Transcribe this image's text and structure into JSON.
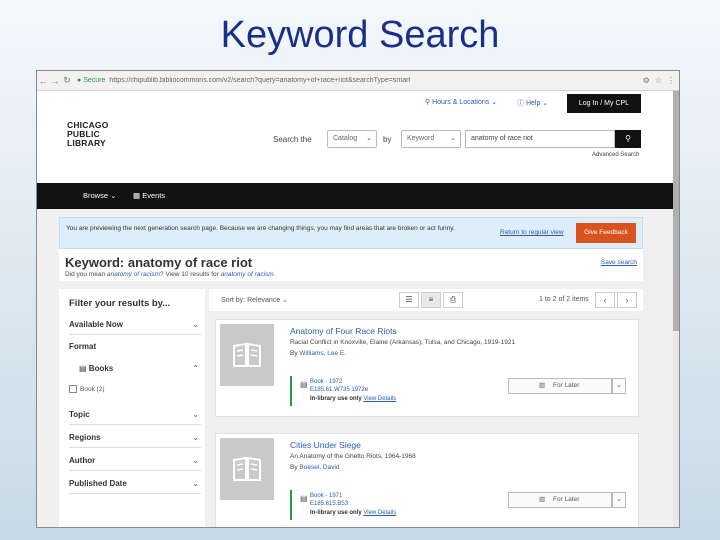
{
  "slide": {
    "title": "Keyword Search"
  },
  "browser": {
    "secure_label": "Secure",
    "url": "https://chipublib.bibliocommons.com/v2/search?query=anatomy+of+race+riot&searchType=smart"
  },
  "utility": {
    "hours_label": "Hours & Locations",
    "help_label": "Help",
    "login_label": "Log In / My CPL"
  },
  "header": {
    "logo_lines": [
      "CHICAGO",
      "PUBLIC",
      "LIBRARY"
    ],
    "search_the_label": "Search the",
    "scope_value": "Catalog",
    "by_label": "by",
    "type_value": "Keyword",
    "query_value": "anatomy of race riot",
    "advanced_search_label": "Advanced Search"
  },
  "nav": {
    "browse_label": "Browse",
    "events_label": "Events"
  },
  "banner": {
    "text": "You are previewing the next generation search page. Because we are changing things, you may find areas that are broken or act funny.",
    "return_label": "Return to regular view",
    "feedback_label": "Give Feedback"
  },
  "keyword": {
    "heading": "Keyword: anatomy of race riot",
    "did_you_mean_prefix": "Did you mean",
    "did_you_mean_link": "anatomy of racism",
    "did_you_mean_middle": "View 10 results for",
    "did_you_mean_link2": "anatomy of racism.",
    "save_search_label": "Save search"
  },
  "filters": {
    "title": "Filter your results by...",
    "available_now": "Available Now",
    "format": "Format",
    "books": "Books",
    "book_option": "Book (2)",
    "topic": "Topic",
    "regions": "Regions",
    "author": "Author",
    "published_date": "Published Date"
  },
  "results_toolbar": {
    "sort_label": "Sort by: Relevance",
    "count_label": "1 to 2 of 2 items"
  },
  "results": [
    {
      "title": "Anatomy of Four Race Riots",
      "subtitle": "Racial Conflict in Knoxville, Elaine (Arkansas), Tulsa, and Chicago, 1919-1921",
      "by_label": "By",
      "author": "Williams, Lee E.",
      "format_line1": "Book - 1972",
      "format_line2": "E185.61.W735 1972e",
      "availability": "In-library use only",
      "view_details": "View Details",
      "for_later": "For Later"
    },
    {
      "title": "Cities Under Siege",
      "subtitle": "An Anatomy of the Ghetto Riots, 1964-1968",
      "by_label": "By",
      "author": "Boesel, David",
      "format_line1": "Book - 1971",
      "format_line2": "E185.615.B53",
      "availability": "In-library use only",
      "view_details": "View Details",
      "for_later": "For Later"
    }
  ],
  "colors": {
    "title_blue": "#1a2f8a",
    "link_blue": "#2a5db0",
    "feedback_orange": "#d9531e",
    "available_green": "#2a9a3a",
    "nav_black": "#111111"
  },
  "icons": {
    "back": "arrow-left-icon",
    "forward": "arrow-right-icon",
    "reload": "reload-icon",
    "search": "search-icon",
    "book": "book-icon",
    "shelf": "shelf-icon"
  }
}
